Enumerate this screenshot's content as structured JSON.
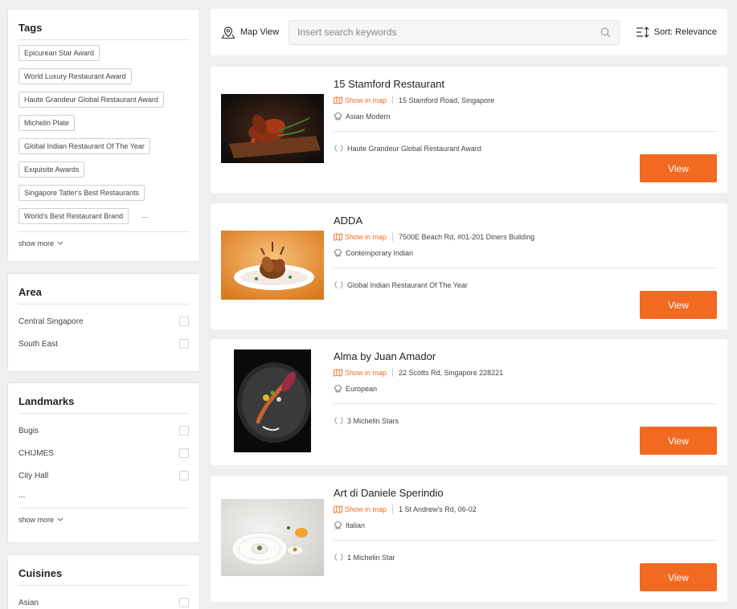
{
  "sidebar": {
    "tags": {
      "title": "Tags",
      "items": [
        "Epicurean Star Award",
        "World Luxury Restaurant Award",
        "Haute Grandeur Global Restaurant Award",
        "Michelin Plate",
        "Global Indian Restaurant Of The Year",
        "Exquisite Awards",
        "Singapore Tatler's Best Restaurants",
        "World's Best Restaurant Brand"
      ],
      "ellipsis": "...",
      "show_more": "show more"
    },
    "area": {
      "title": "Area",
      "items": [
        "Central Singapore",
        "South East"
      ]
    },
    "landmarks": {
      "title": "Landmarks",
      "items": [
        "Bugis",
        "CHIJMES",
        "City Hall"
      ],
      "ellipsis": "...",
      "show_more": "show more"
    },
    "cuisines": {
      "title": "Cuisines",
      "items": [
        "Asian"
      ]
    }
  },
  "topbar": {
    "map_view": "Map View",
    "search_placeholder": "Insert search keywords",
    "sort": "Sort: Relevance"
  },
  "restaurants": [
    {
      "name": "15 Stamford Restaurant",
      "show_in_map": "Show in map",
      "address": "15 Stamford Road, Singapore",
      "cuisine": "Asian Modern",
      "award": "Haute Grandeur Global Restaurant Award",
      "button": "View"
    },
    {
      "name": "ADDA",
      "show_in_map": "Show in map",
      "address": "7500E Beach Rd, #01-201 Diners Building",
      "cuisine": "Contemporary Indian",
      "award": "Global Indian Restaurant Of The Year",
      "button": "View"
    },
    {
      "name": "Alma by Juan Amador",
      "show_in_map": "Show in map",
      "address": "22 Scotts Rd, Singapore 228221",
      "cuisine": "European",
      "award": "3 Michelin Stars",
      "button": "View"
    },
    {
      "name": "Art di Daniele Sperindio",
      "show_in_map": "Show in map",
      "address": "1 St Andrew's Rd, 06-02",
      "cuisine": "Italian",
      "award": "1 Michelin Star",
      "button": "View"
    }
  ],
  "colors": {
    "accent": "#f26a21",
    "background": "#efefef"
  }
}
